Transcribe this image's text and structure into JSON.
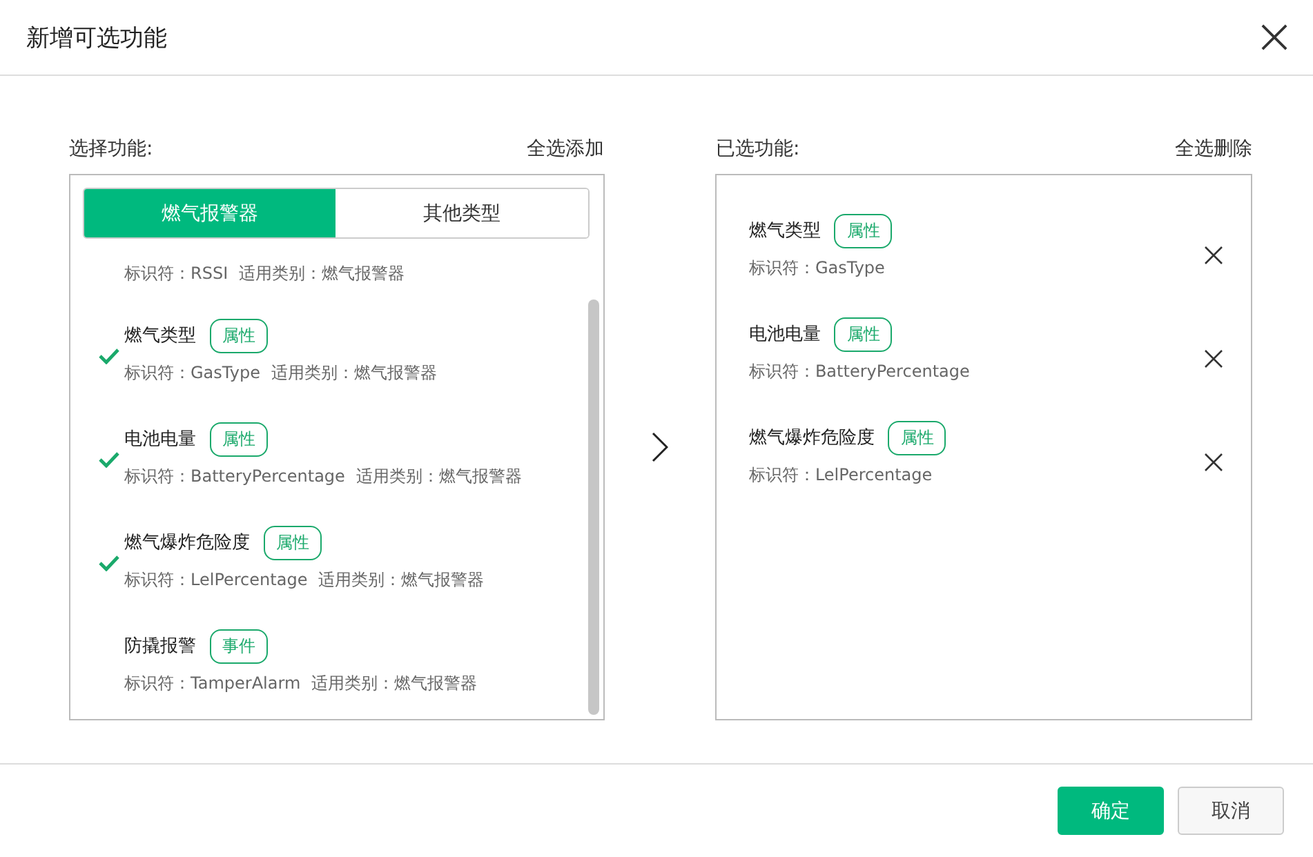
{
  "dialog": {
    "title": "新增可选功能"
  },
  "available": {
    "label": "选择功能:",
    "action": "全选添加",
    "tabs": [
      {
        "label": "燃气报警器",
        "selected": true
      },
      {
        "label": "其他类型",
        "selected": false
      }
    ],
    "items": [
      {
        "identifier": "标识符：RSSI",
        "category": "适用类别：燃气报警器",
        "checked": false
      },
      {
        "name": "燃气类型",
        "tag": "属性",
        "identifier": "标识符：GasType",
        "category": "适用类别：燃气报警器",
        "checked": true
      },
      {
        "name": "电池电量",
        "tag": "属性",
        "identifier": "标识符：BatteryPercentage",
        "category": "适用类别：燃气报警器",
        "checked": true
      },
      {
        "name": "燃气爆炸危险度",
        "tag": "属性",
        "identifier": "标识符：LelPercentage",
        "category": "适用类别：燃气报警器",
        "checked": true
      },
      {
        "name": "防撬报警",
        "tag": "事件",
        "identifier": "标识符：TamperAlarm",
        "category": "适用类别：燃气报警器",
        "checked": false
      }
    ]
  },
  "selected": {
    "label": "已选功能:",
    "action": "全选删除",
    "items": [
      {
        "name": "燃气类型",
        "tag": "属性",
        "identifier": "标识符：GasType"
      },
      {
        "name": "电池电量",
        "tag": "属性",
        "identifier": "标识符：BatteryPercentage"
      },
      {
        "name": "燃气爆炸危险度",
        "tag": "属性",
        "identifier": "标识符：LelPercentage"
      }
    ]
  },
  "buttons": [
    {
      "label": "确定",
      "kind": "primary"
    },
    {
      "label": "取消",
      "kind": "default"
    }
  ]
}
